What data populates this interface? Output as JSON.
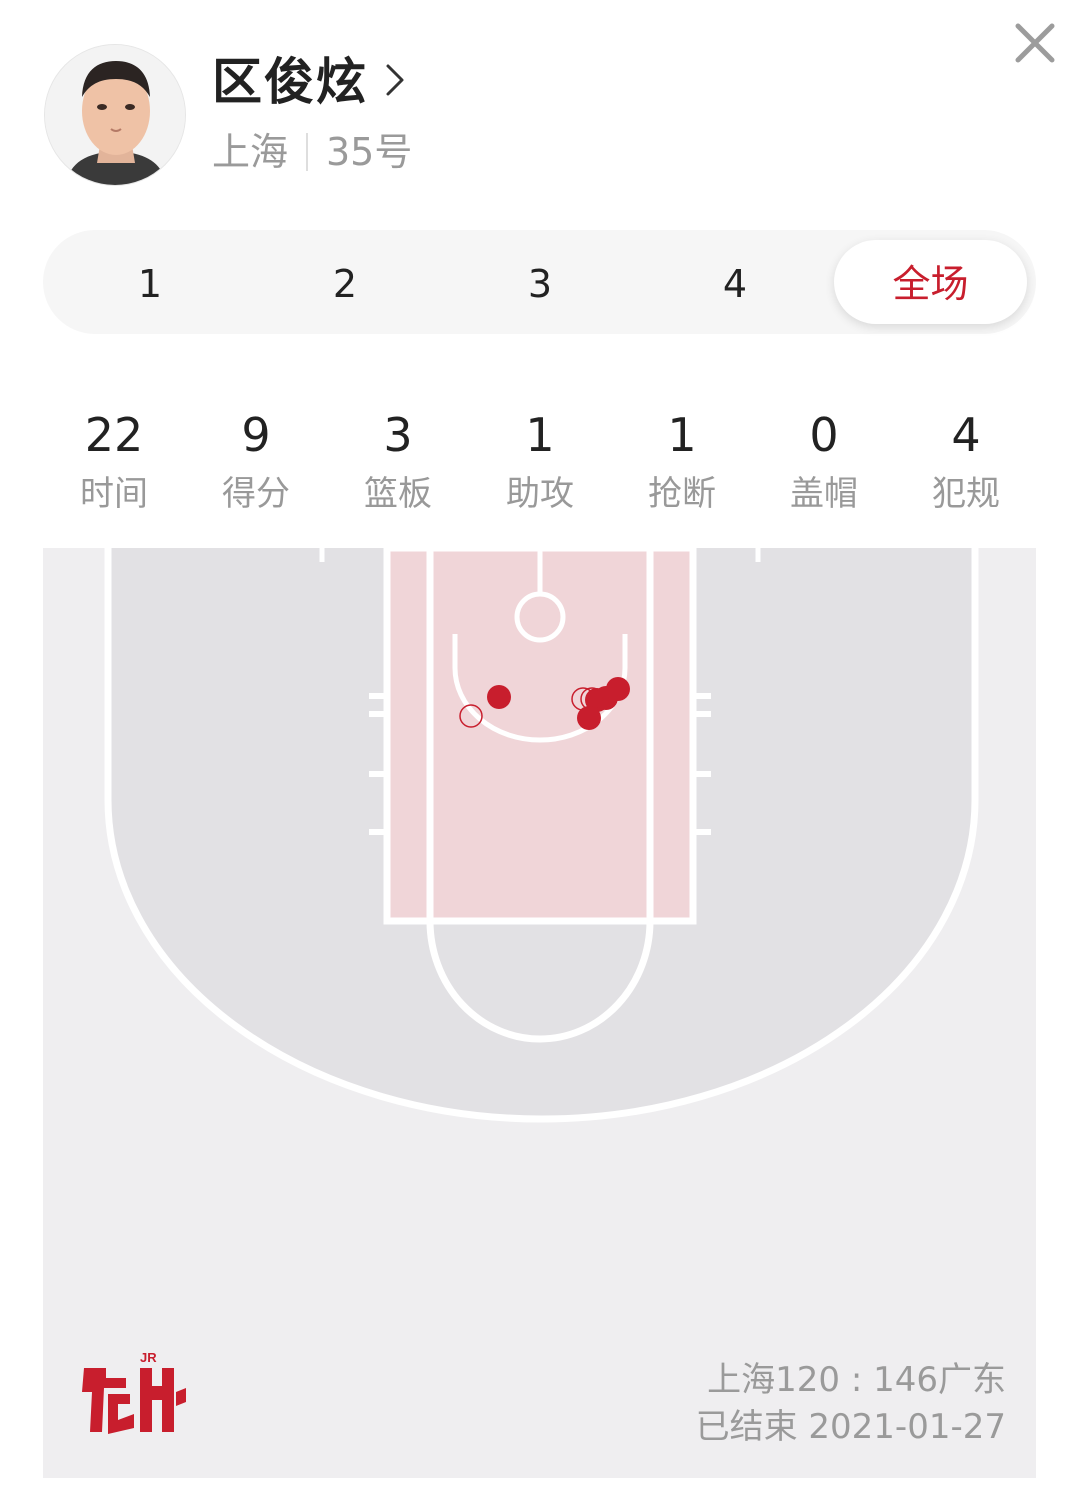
{
  "player": {
    "name": "区俊炫",
    "team": "上海",
    "number": "35号"
  },
  "tabs": [
    {
      "label": "1",
      "active": false
    },
    {
      "label": "2",
      "active": false
    },
    {
      "label": "3",
      "active": false
    },
    {
      "label": "4",
      "active": false
    },
    {
      "label": "全场",
      "active": true
    }
  ],
  "stats": [
    {
      "value": "22",
      "label": "时间"
    },
    {
      "value": "9",
      "label": "得分"
    },
    {
      "value": "3",
      "label": "篮板"
    },
    {
      "value": "1",
      "label": "助攻"
    },
    {
      "value": "1",
      "label": "抢断"
    },
    {
      "value": "0",
      "label": "盖帽"
    },
    {
      "value": "4",
      "label": "犯规"
    }
  ],
  "shot_chart": {
    "made_color": "#c81e2d",
    "missed_color": "#c81e2d",
    "shots": [
      {
        "result": "made"
      },
      {
        "result": "missed"
      },
      {
        "result": "missed"
      },
      {
        "result": "made"
      },
      {
        "result": "made"
      },
      {
        "result": "made"
      },
      {
        "result": "missed"
      },
      {
        "result": "made"
      }
    ]
  },
  "game": {
    "score": "上海120 : 146广东",
    "status": "已结束 2021-01-27"
  },
  "icons": {
    "close": "close-icon",
    "chevron": "chevron-right-icon",
    "logo": "hupu-logo-icon"
  },
  "colors": {
    "accent": "#c81e2d",
    "muted_text": "#999999",
    "court_bg": "#efeef0",
    "court_zone": "#e2e1e4",
    "paint": "#f0d5d8"
  }
}
